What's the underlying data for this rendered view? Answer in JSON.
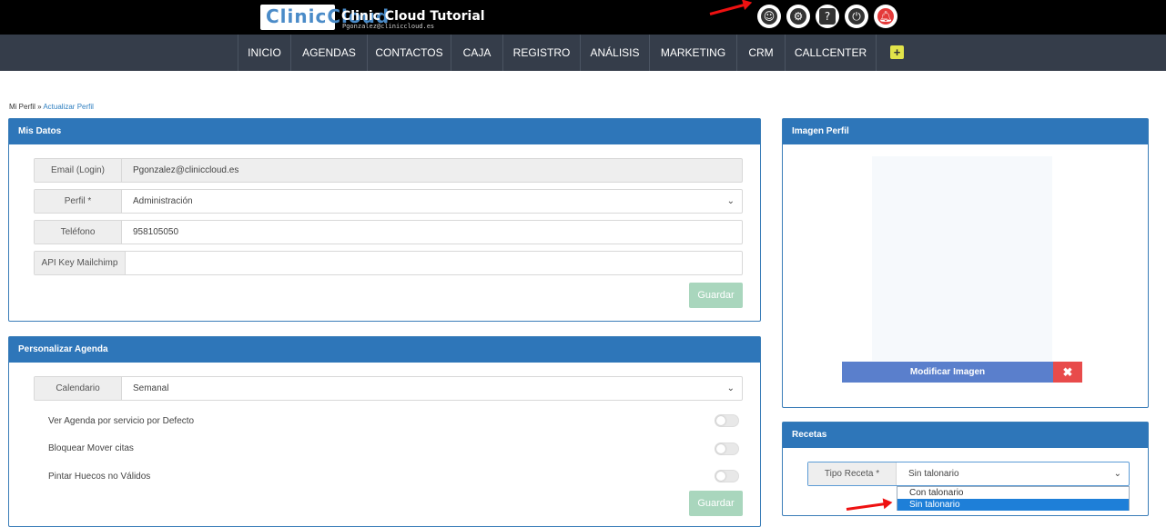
{
  "header": {
    "logo_text": "ClinicCloud",
    "title": "Clinic Cloud Tutorial",
    "subtitle": "Pgonzalez@cliniccloud.es",
    "icons": [
      "user-profile-icon",
      "gear-icon",
      "help-icon",
      "power-icon",
      "alert-bell-icon"
    ]
  },
  "nav": {
    "items": [
      "INICIO",
      "AGENDAS",
      "CONTACTOS",
      "CAJA",
      "REGISTRO",
      "ANÁLISIS",
      "MARKETING",
      "CRM",
      "CALLCENTER"
    ],
    "plus_label": "+"
  },
  "breadcrumb": {
    "root": "Mi Perfil",
    "separator": " » ",
    "current": "Actualizar Perfil"
  },
  "mis_datos": {
    "title": "Mis Datos",
    "email_label": "Email (Login)",
    "email_value": "Pgonzalez@cliniccloud.es",
    "perfil_label": "Perfil *",
    "perfil_value": "Administración",
    "telefono_label": "Teléfono",
    "telefono_value": "958105050",
    "api_label": "API Key Mailchimp",
    "api_value": "",
    "save_label": "Guardar"
  },
  "agenda": {
    "title": "Personalizar Agenda",
    "calendario_label": "Calendario",
    "calendario_value": "Semanal",
    "options": [
      {
        "label": "Ver Agenda por servicio por Defecto",
        "on": false
      },
      {
        "label": "Bloquear Mover citas",
        "on": false
      },
      {
        "label": "Pintar Huecos no Válidos",
        "on": false
      }
    ],
    "save_label": "Guardar"
  },
  "imagen": {
    "title": "Imagen Perfil",
    "modify_label": "Modificar Imagen",
    "remove_label": "✖"
  },
  "recetas": {
    "title": "Recetas",
    "tipo_label": "Tipo Receta *",
    "tipo_value": "Sin talonario",
    "dropdown_options": [
      "Con talonario",
      "Sin talonario"
    ],
    "selected_option": "Sin talonario"
  },
  "colors": {
    "topbar": "#000000",
    "navbar": "#353d4a",
    "panel_header": "#2e76b9",
    "save_button": "#a9d6bd",
    "modify_button": "#5a7fcc",
    "remove_button": "#e84b4b",
    "annotation_arrow": "#ee1111"
  }
}
